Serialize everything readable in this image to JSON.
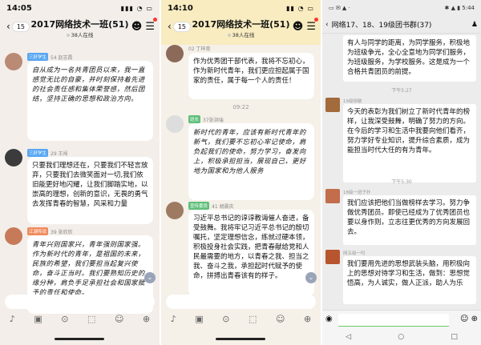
{
  "panel1": {
    "status_time": "14:05",
    "status_icons": "▮▮▮ ◔ ▭",
    "back_count": "15",
    "title": "2017网络技术一班(51)",
    "online": "38人在线",
    "messages": [
      {
        "tag": "三好学生",
        "tag_color": "#58a6f2",
        "meta": "54 赵志霞",
        "text": "自从成为一名共青团员以来，我一直感觉无比的自豪，并时刻保持着先进的社会责任感和集体荣誉感，然后团结，坚持正确的思想和政治方向。"
      },
      {
        "tag": "三好学生",
        "tag_color": "#58a6f2",
        "meta": "29 王闯",
        "text": "只要我们理想还在，只要我们不轻言放弃，只要我们去微笑面对一切,我们依旧能更好地闪耀，让我们脚踏实地，以崇高的理想，创新的意识，无畏的勇气去发挥青春的智慧，风采和力量"
      },
      {
        "tag": "江湖传说",
        "tag_color": "#f08a5b",
        "meta": "39 张欣欣",
        "text": "青年兴则国家兴，青年强则国家强。作为新时代的青年，是祖国的未来，民族的希望，我们要担当起复兴使命，奋斗正当时。我们要熟知历史的缘分种，肩负手足承担社会和国家赋予的责任和使命。"
      }
    ],
    "toolbar": [
      "♪",
      "▣",
      "⊙",
      "⬚",
      "☺",
      "⊕"
    ]
  },
  "panel2": {
    "status_time": "14:10",
    "status_icons": "▮▮ ◔ ▭",
    "back_count": "15",
    "title": "2017网络技术一班(51)",
    "online": "38人在线",
    "messages": [
      {
        "tag": "",
        "tag_color": "",
        "meta": "02 丁梓育",
        "text": "作为优秀团干部代表，我将不忘初心，作为新时代青年，我们更应担起属于国家的责任，属于每一个人的责任！"
      },
      {
        "time": "09:22"
      },
      {
        "tag": "班长",
        "tag_color": "#5fbf7a",
        "meta": "37张洪瑞",
        "text": "新时代的青年，应该有新时代青年的新气，我们要不忘初心牢记使命，肩负起我们的使命，努力学习，奋发向上，积极承担担当，展现自己，更好地为国家和为他人服务"
      },
      {
        "tag": "宣传委员",
        "tag_color": "#5fbf7a",
        "meta": "41 胡晨庆",
        "text": "习近平总书记的谆谆教诲催人奋进，备受鼓舞。我将牢记习近平总书记的殷切嘱托，坚定理想信念，练就过硬本领，积极投身社会实践，把青春献给党和人民最需要的地方，以青春之我、担当之我、奋斗之我，承担起时代赋予的使命，拼搏出青春该有的样子。"
      }
    ],
    "toolbar": [
      "♪",
      "▣",
      "⊙",
      "⬚",
      "☺",
      "⊕"
    ]
  },
  "panel3": {
    "status_left": "▭ ✉ ▲ ·",
    "status_right": "✱ ▲ ▮ 5:44",
    "title": "网络17、18、19级团书群(37)",
    "messages": [
      {
        "name": "",
        "text": "有人与同学的距离，为同学服务，积极地为班级争光，全心全意地为同学们服务，为班级服务，为学校服务。这是成为一个合格共青团员的前提。"
      },
      {
        "time": "下午5:27"
      },
      {
        "name": "19级徐敏",
        "text": "今天的表彰为我们树立了新时代青年的榜样，让我深受鼓舞，明确了努力的方向。在今后的学习和生活中我要向他们看齐，努力学好专业知识，提升综合素质，成为能担当时代大任的有为青年。"
      },
      {
        "time": "下午5:30"
      },
      {
        "name": "18级一班子扑",
        "text": "我们应该把他们当做榜样去学习。努力争做优秀团员。即使已经成为了优秀团员也要以身作则，立志往更优秀的方向发展回去。"
      },
      {
        "name": "网五级一吗",
        "text": "我们要用先进的思想武装头脑，用积极向上的思想对待学习和生活，做到：思想觉悟高，为人诚实，做人正派，助人为乐"
      }
    ],
    "input_left": "◉",
    "input_right": "☺ ⊕",
    "nav": [
      "◁",
      "○",
      "□"
    ]
  }
}
